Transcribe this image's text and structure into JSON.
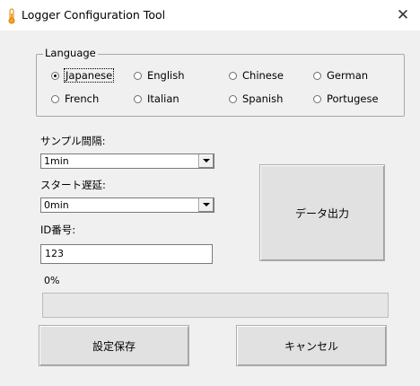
{
  "window": {
    "title": "Logger Configuration Tool"
  },
  "language_group": {
    "label": "Language",
    "options": [
      {
        "label": "Japanese",
        "checked": true
      },
      {
        "label": "English",
        "checked": false
      },
      {
        "label": "Chinese",
        "checked": false
      },
      {
        "label": "German",
        "checked": false
      },
      {
        "label": "French",
        "checked": false
      },
      {
        "label": "Italian",
        "checked": false
      },
      {
        "label": "Spanish",
        "checked": false
      },
      {
        "label": "Portugese",
        "checked": false
      }
    ]
  },
  "sample_interval": {
    "label": "サンプル間隔:",
    "value": "1min"
  },
  "start_delay": {
    "label": "スタート遅延:",
    "value": "0min"
  },
  "id_number": {
    "label": "ID番号:",
    "value": "123"
  },
  "export_button": {
    "label": "データ出力"
  },
  "progress": {
    "text": "0%",
    "value": 0
  },
  "save_button": {
    "label": "設定保存"
  },
  "cancel_button": {
    "label": "キャンセル"
  },
  "colors": {
    "progress_fill": "#06b025",
    "title_icon": "#f5a623"
  },
  "icons": {
    "app": "thermometer-icon",
    "close": "close-icon"
  }
}
